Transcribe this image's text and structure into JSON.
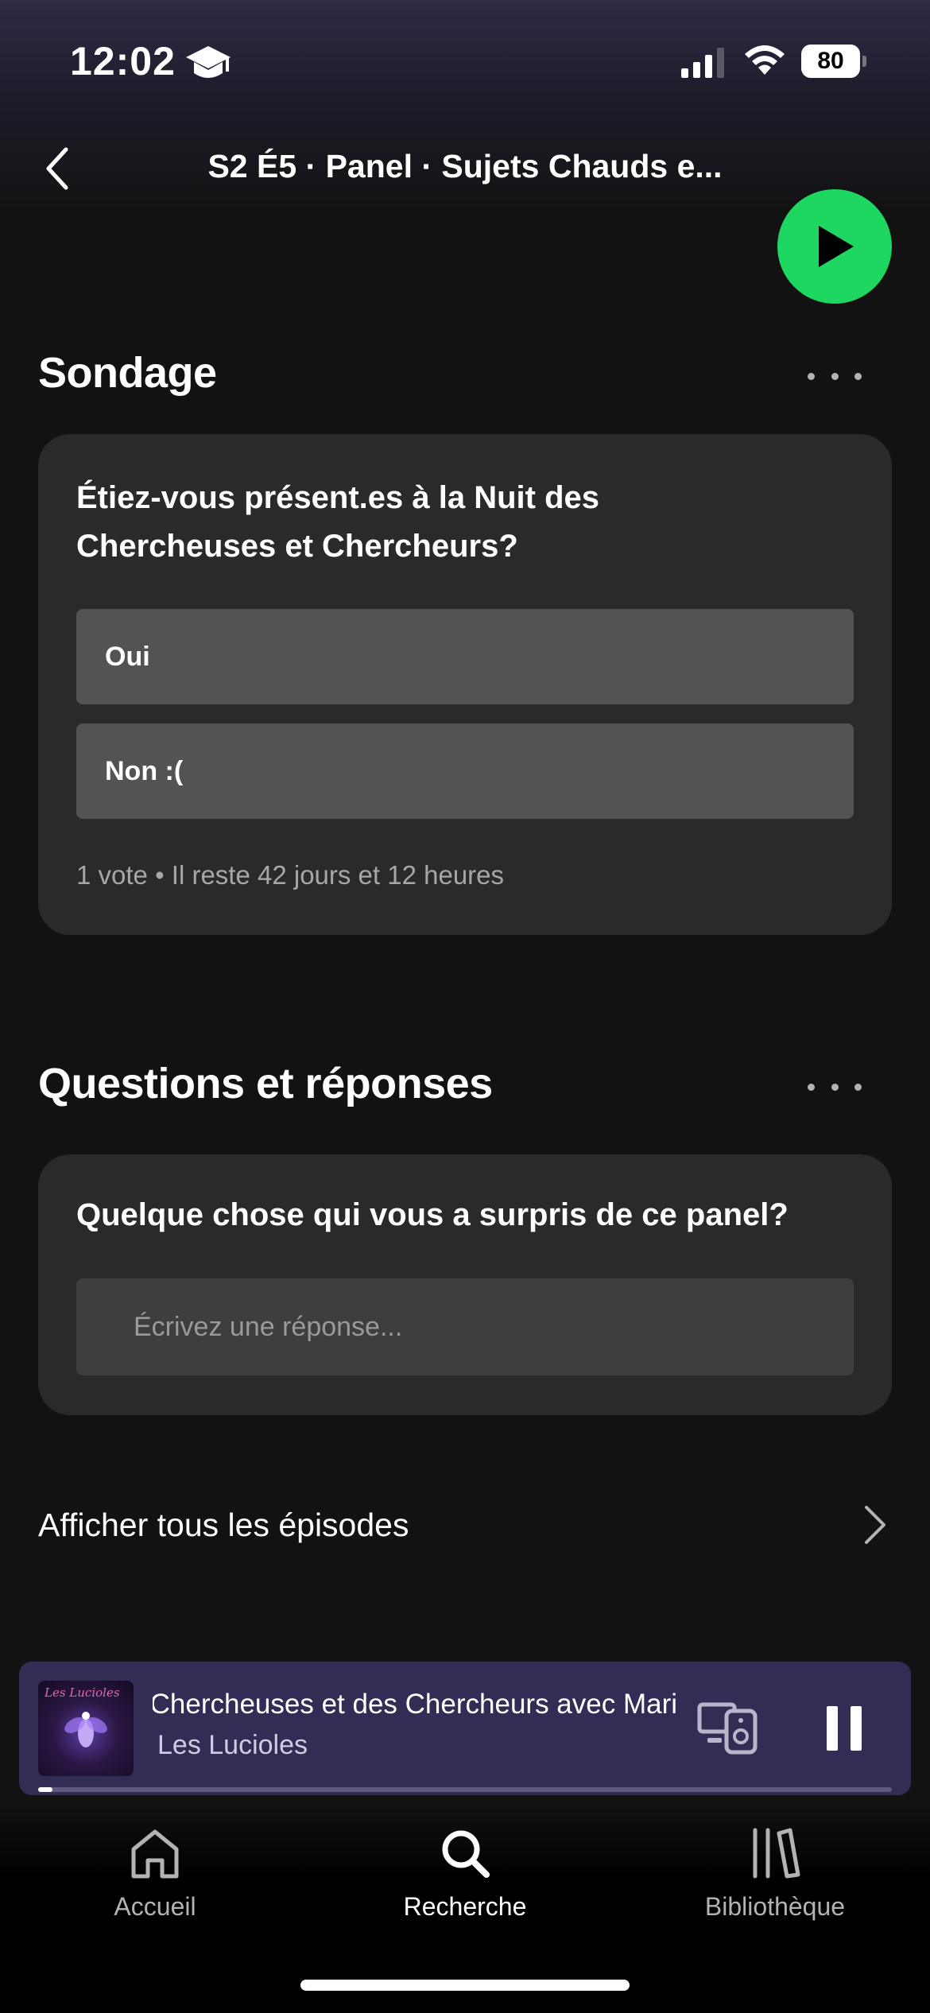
{
  "status_bar": {
    "time": "12:02",
    "battery": "80"
  },
  "header": {
    "title": "S2 É5 · Panel · Sujets Chauds e..."
  },
  "poll": {
    "section_title": "Sondage",
    "question": "Étiez-vous présent.es à la Nuit des Chercheuses et Chercheurs?",
    "options": [
      {
        "label": "Oui"
      },
      {
        "label": "Non :("
      }
    ],
    "meta": "1 vote • Il reste 42 jours et 12 heures"
  },
  "qa": {
    "section_title": "Questions et réponses",
    "question": "Quelque chose qui vous a surpris de ce panel?",
    "input_placeholder": "Écrivez une réponse..."
  },
  "all_episodes": {
    "label": "Afficher tous les épisodes"
  },
  "mini_player": {
    "title": "Chercheuses et des Chercheurs avec Mari",
    "artist": "Les Lucioles",
    "cover_text": "Les Lucioles",
    "progress": 0.01
  },
  "bottom_nav": {
    "items": [
      {
        "label": "Accueil",
        "icon": "home-icon",
        "active": false
      },
      {
        "label": "Recherche",
        "icon": "search-icon",
        "active": true
      },
      {
        "label": "Bibliothèque",
        "icon": "library-icon",
        "active": false
      }
    ]
  },
  "colors": {
    "accent": "#1ed760",
    "background": "#121212",
    "card": "#2a2a2a",
    "mini_player": "#322d55",
    "inactive_nav": "#b3b3b3"
  }
}
